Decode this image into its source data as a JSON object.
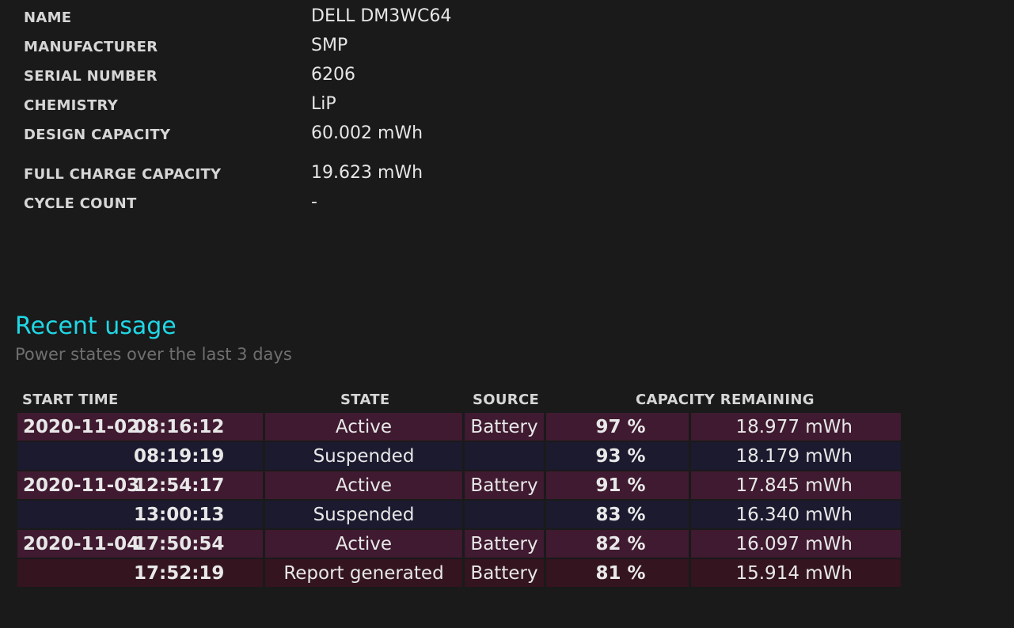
{
  "battery_info": [
    {
      "label": "NAME",
      "value": "DELL DM3WC64"
    },
    {
      "label": "MANUFACTURER",
      "value": "SMP"
    },
    {
      "label": "SERIAL NUMBER",
      "value": "6206"
    },
    {
      "label": "CHEMISTRY",
      "value": "LiP"
    },
    {
      "label": "DESIGN CAPACITY",
      "value": "60.002 mWh"
    },
    {
      "label": "FULL CHARGE CAPACITY",
      "value": "19.623 mWh"
    },
    {
      "label": "CYCLE COUNT",
      "value": "-"
    }
  ],
  "recent_usage": {
    "title": "Recent usage",
    "subtitle": "Power states over the last 3 days",
    "headers": {
      "start_time": "START TIME",
      "state": "STATE",
      "source": "SOURCE",
      "capacity_remaining": "CAPACITY REMAINING"
    },
    "rows": [
      {
        "date": "2020-11-02",
        "time": "08:16:12",
        "state": "Active",
        "source": "Battery",
        "percent": "97 %",
        "mwh": "18.977 mWh",
        "kind": "active"
      },
      {
        "date": "",
        "time": "08:19:19",
        "state": "Suspended",
        "source": "",
        "percent": "93 %",
        "mwh": "18.179 mWh",
        "kind": "suspended"
      },
      {
        "date": "2020-11-03",
        "time": "12:54:17",
        "state": "Active",
        "source": "Battery",
        "percent": "91 %",
        "mwh": "17.845 mWh",
        "kind": "active"
      },
      {
        "date": "",
        "time": "13:00:13",
        "state": "Suspended",
        "source": "",
        "percent": "83 %",
        "mwh": "16.340 mWh",
        "kind": "suspended"
      },
      {
        "date": "2020-11-04",
        "time": "17:50:54",
        "state": "Active",
        "source": "Battery",
        "percent": "82 %",
        "mwh": "16.097 mWh",
        "kind": "active"
      },
      {
        "date": "",
        "time": "17:52:19",
        "state": "Report generated",
        "source": "Battery",
        "percent": "81 %",
        "mwh": "15.914 mWh",
        "kind": "report"
      }
    ]
  },
  "colors": {
    "background": "#1a1a1a",
    "heading_accent": "#1fd8e6",
    "row_active": "#3f1a30",
    "row_suspended": "#1b1a2f",
    "row_report": "#33141f"
  }
}
